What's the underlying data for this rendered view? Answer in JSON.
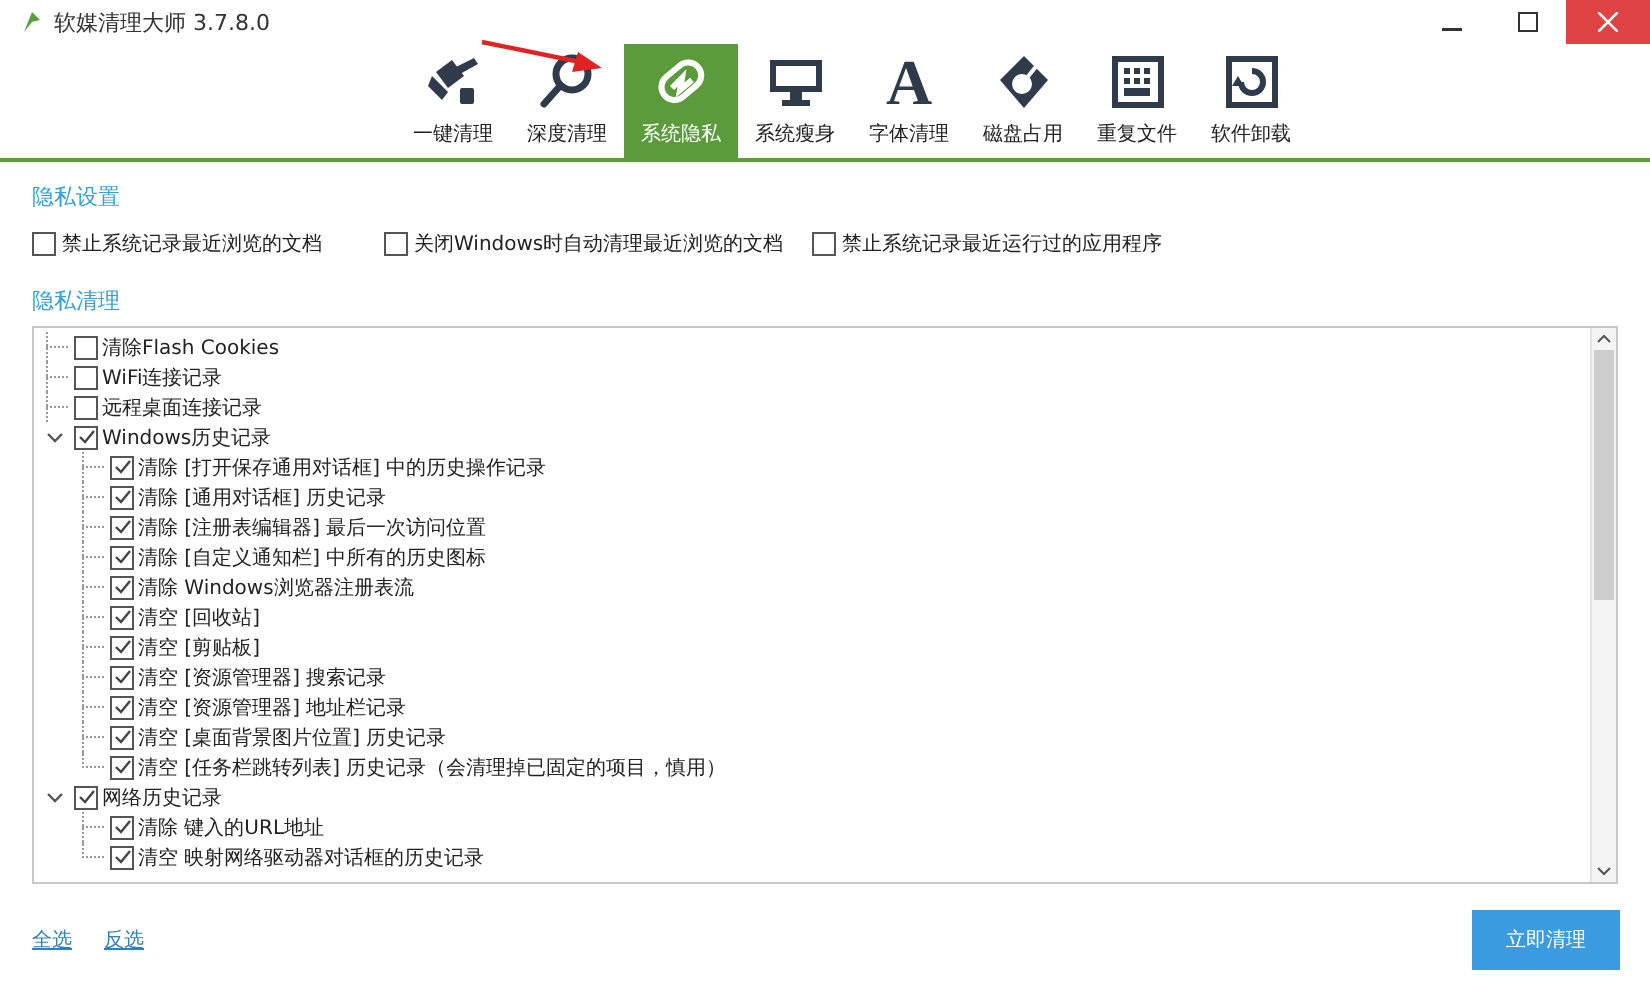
{
  "window": {
    "title": "软媒清理大师 3.7.8.0"
  },
  "tabs": [
    {
      "label": "一键清理",
      "selected": false
    },
    {
      "label": "深度清理",
      "selected": false
    },
    {
      "label": "系统隐私",
      "selected": true
    },
    {
      "label": "系统瘦身",
      "selected": false
    },
    {
      "label": "字体清理",
      "selected": false,
      "glyph": "A"
    },
    {
      "label": "磁盘占用",
      "selected": false
    },
    {
      "label": "重复文件",
      "selected": false
    },
    {
      "label": "软件卸载",
      "selected": false
    }
  ],
  "privacy_settings": {
    "heading": "隐私设置",
    "options": [
      {
        "label": "禁止系统记录最近浏览的文档",
        "checked": false
      },
      {
        "label": "关闭Windows时自动清理最近浏览的文档",
        "checked": false
      },
      {
        "label": "禁止系统记录最近运行过的应用程序",
        "checked": false
      }
    ]
  },
  "privacy_cleanup": {
    "heading": "隐私清理",
    "items": [
      {
        "label": "清除Flash Cookies",
        "checked": false
      },
      {
        "label": "WiFi连接记录",
        "checked": false
      },
      {
        "label": "远程桌面连接记录",
        "checked": false
      },
      {
        "label": "Windows历史记录",
        "checked": true,
        "expanded": true,
        "children": [
          {
            "label": "清除 [打开保存通用对话框] 中的历史操作记录",
            "checked": true
          },
          {
            "label": "清除 [通用对话框] 历史记录",
            "checked": true
          },
          {
            "label": "清除 [注册表编辑器] 最后一次访问位置",
            "checked": true
          },
          {
            "label": "清除 [自定义通知栏] 中所有的历史图标",
            "checked": true
          },
          {
            "label": "清除 Windows浏览器注册表流",
            "checked": true
          },
          {
            "label": "清空 [回收站]",
            "checked": true
          },
          {
            "label": "清空 [剪贴板]",
            "checked": true
          },
          {
            "label": "清空 [资源管理器] 搜索记录",
            "checked": true
          },
          {
            "label": "清空 [资源管理器] 地址栏记录",
            "checked": true
          },
          {
            "label": "清空 [桌面背景图片位置] 历史记录",
            "checked": true
          },
          {
            "label": "清空 [任务栏跳转列表] 历史记录（会清理掉已固定的项目，慎用）",
            "checked": true
          }
        ]
      },
      {
        "label": "网络历史记录",
        "checked": true,
        "expanded": true,
        "children": [
          {
            "label": "清除 键入的URL地址",
            "checked": true
          },
          {
            "label": "清空 映射网络驱动器对话框的历史记录",
            "checked": true
          }
        ]
      }
    ]
  },
  "footer": {
    "links": [
      "全选",
      "反选"
    ],
    "button": "立即清理"
  }
}
